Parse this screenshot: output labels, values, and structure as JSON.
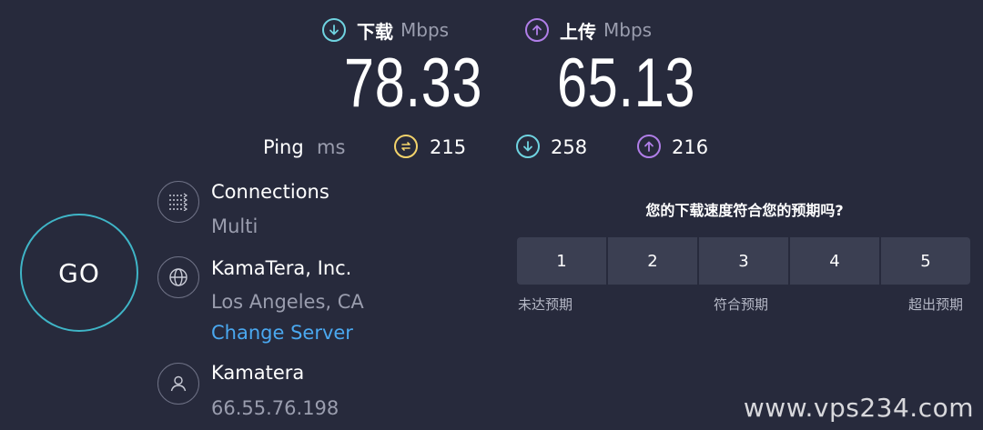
{
  "download": {
    "label": "下载",
    "unit": "Mbps",
    "value": "78.33"
  },
  "upload": {
    "label": "上传",
    "unit": "Mbps",
    "value": "65.13"
  },
  "ping": {
    "label": "Ping",
    "unit": "ms",
    "idle": "215",
    "down": "258",
    "up": "216"
  },
  "go_label": "GO",
  "connections": {
    "title": "Connections",
    "value": "Multi"
  },
  "server": {
    "name": "KamaTera, Inc.",
    "location": "Los Angeles, CA",
    "change_label": "Change Server"
  },
  "host": {
    "name": "Kamatera",
    "ip": "66.55.76.198"
  },
  "survey": {
    "question": "您的下载速度符合您的预期吗?",
    "options": [
      "1",
      "2",
      "3",
      "4",
      "5"
    ],
    "low_label": "未达预期",
    "mid_label": "符合预期",
    "high_label": "超出预期"
  },
  "watermark": "www.vps234.com",
  "colors": {
    "background": "#272a3c",
    "download_accent": "#6fd3e0",
    "upload_accent": "#b07ee8",
    "ping_accent": "#f3d36b",
    "go_ring": "#3fb5c7",
    "link": "#4aa8f0"
  },
  "icons": {
    "download": "arrow-down-circle-icon",
    "upload": "arrow-up-circle-icon",
    "ping": "ping-jitter-icon",
    "connections": "connections-icon",
    "server": "globe-icon",
    "host": "user-icon"
  }
}
